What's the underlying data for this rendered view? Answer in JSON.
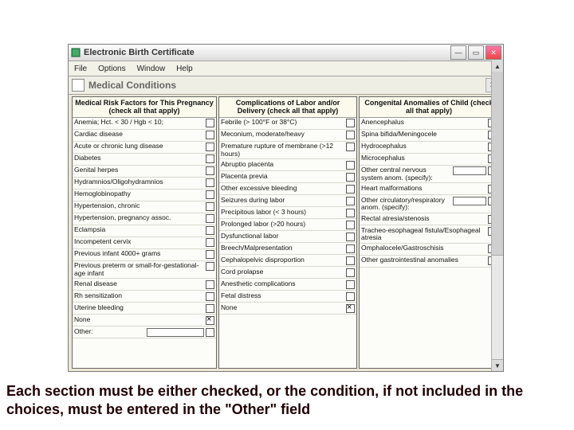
{
  "window": {
    "title": "Electronic Birth Certificate",
    "menus": [
      "File",
      "Options",
      "Window",
      "Help"
    ],
    "section_label": "Medical  Conditions"
  },
  "col1": {
    "header": "Medical Risk Factors for This Pregnancy (check all that apply)",
    "items": [
      "Anemia; Hct. < 30 / Hgb < 10;",
      "Cardiac disease",
      "Acute or chronic lung disease",
      "Diabetes",
      "Genital herpes",
      "Hydramnios/Oligohydramnios",
      "Hemoglobinopathy",
      "Hypertension, chronic",
      "Hypertension, pregnancy assoc.",
      "Eclampsia",
      "Incompetent cervix",
      "Previous infant 4000+ grams",
      "Previous preterm or small-for-gestational-age infant",
      "Renal disease",
      "Rh sensitization",
      "Uterine bleeding"
    ],
    "none_label": "None",
    "other_label": "Other:"
  },
  "col2": {
    "header": "Complications of Labor and/or Delivery (check all that apply)",
    "items": [
      "Febrile (> 100°F or 38°C)",
      "Meconium, moderate/heavy",
      "Premature rupture of membrane (>12 hours)",
      "Abruptio placenta",
      "Placenta previa",
      "Other excessive bleeding",
      "Seizures during labor",
      "Precipitous labor (< 3 hours)",
      "Prolonged labor (>20 hours)",
      "Dysfunctional labor",
      "Breech/Malpresentation",
      "Cephalopelvic disproportion",
      "Cord prolapse",
      "Anesthetic complications",
      "Fetal distress"
    ],
    "none_label": "None"
  },
  "col3": {
    "header": "Congenital Anomalies of Child (check all that apply)",
    "items_a": [
      "Anencephalus",
      "Spina bifida/Meningocele",
      "Hydrocephalus",
      "Microcephalus"
    ],
    "specify_a": "Other central nervous system anom. (specify):",
    "items_b": [
      "Heart malformations"
    ],
    "specify_b": "Other circulatory/respiratory anom. (specify):",
    "items_c": [
      "Rectal atresia/stenosis",
      "Tracheo-esophageal fistula/Esophageal atresia",
      "Omphalocele/Gastroschisis",
      "Other gastrointestinal anomalies"
    ]
  },
  "caption": "Each section must be either checked, or the condition, if not included in the choices, must be entered in the \"Other\" field"
}
